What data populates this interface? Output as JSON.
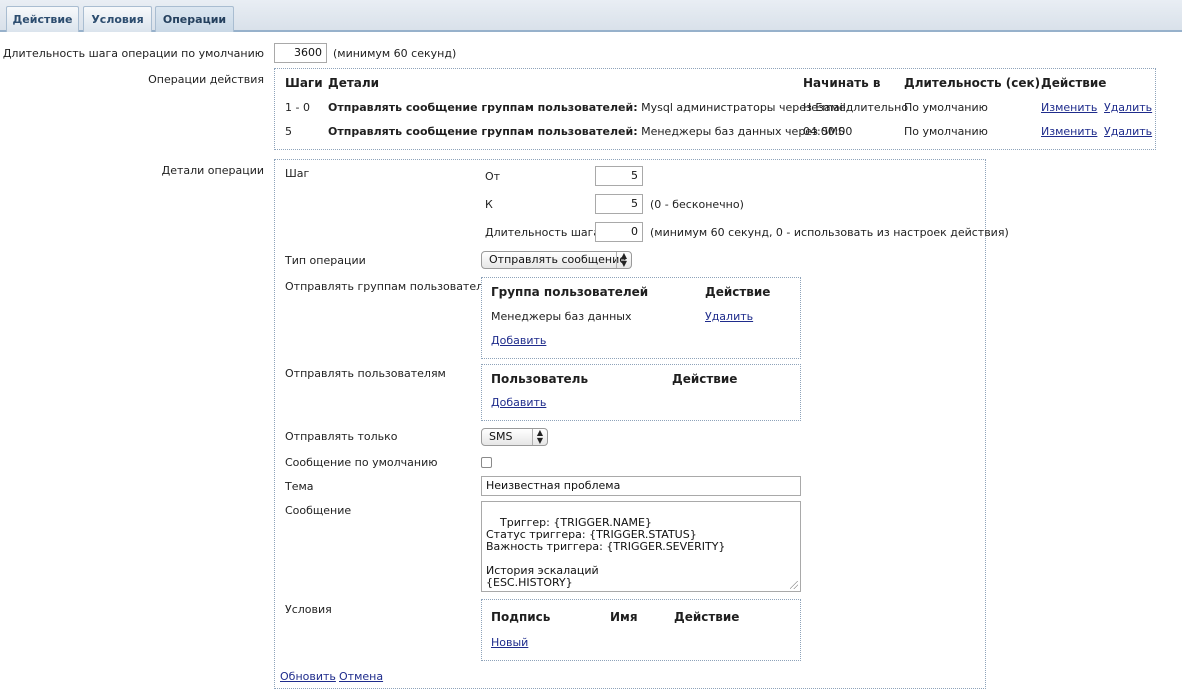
{
  "tabs": [
    {
      "label": "Действие"
    },
    {
      "label": "Условия"
    },
    {
      "label": "Операции"
    }
  ],
  "default_step": {
    "label": "Длительность шага операции по умолчанию",
    "value": "3600",
    "hint": "(минимум 60 секунд)"
  },
  "operations": {
    "label": "Операции действия",
    "headers": {
      "steps": "Шаги",
      "details": "Детали",
      "start": "Начинать в",
      "duration": "Длительность (сек)",
      "action": "Действие"
    },
    "rows": [
      {
        "steps": "1 - 0",
        "details_bold": "Отправлять сообщение группам пользователей:",
        "details_rest": " Mysql администраторы через Email",
        "start": "Незамедлительно",
        "duration": "По умолчанию",
        "edit": "Изменить",
        "delete": "Удалить"
      },
      {
        "steps": "5",
        "details_bold": "Отправлять сообщение группам пользователей:",
        "details_rest": " Менеджеры баз данных через SMS",
        "start": "04:00:00",
        "duration": "По умолчанию",
        "edit": "Изменить",
        "delete": "Удалить"
      }
    ]
  },
  "op_details": {
    "label": "Детали операции",
    "step_label": "Шаг",
    "from_label": "От",
    "from_value": "5",
    "to_label": "К",
    "to_value": "5",
    "to_hint": "(0 - бесконечно)",
    "duration_label": "Длительность шага",
    "duration_value": "0",
    "duration_hint": "(минимум 60 секунд, 0 - использовать из настроек действия)",
    "type_label": "Тип операции",
    "type_value": "Отправлять сообщение",
    "groups_label": "Отправлять группам пользователей",
    "groups_header_group": "Группа пользователей",
    "groups_header_action": "Действие",
    "groups_rows": [
      {
        "name": "Менеджеры баз данных",
        "delete": "Удалить"
      }
    ],
    "groups_add": "Добавить",
    "users_label": "Отправлять пользователям",
    "users_header_user": "Пользователь",
    "users_header_action": "Действие",
    "users_add": "Добавить",
    "only_label": "Отправлять только",
    "only_value": "SMS",
    "default_msg_label": "Сообщение по умолчанию",
    "subject_label": "Тема",
    "subject_value": "Неизвестная проблема",
    "message_label": "Сообщение",
    "message_value": "Триггер: {TRIGGER.NAME}\nСтатус триггера: {TRIGGER.STATUS}\nВажность триггера: {TRIGGER.SEVERITY}\n\nИстория эскалаций\n{ESC.HISTORY}",
    "conditions_label": "Условия",
    "cond_header_label": "Подпись",
    "cond_header_name": "Имя",
    "cond_header_action": "Действие",
    "cond_new": "Новый",
    "update": "Обновить",
    "cancel": "Отмена"
  }
}
